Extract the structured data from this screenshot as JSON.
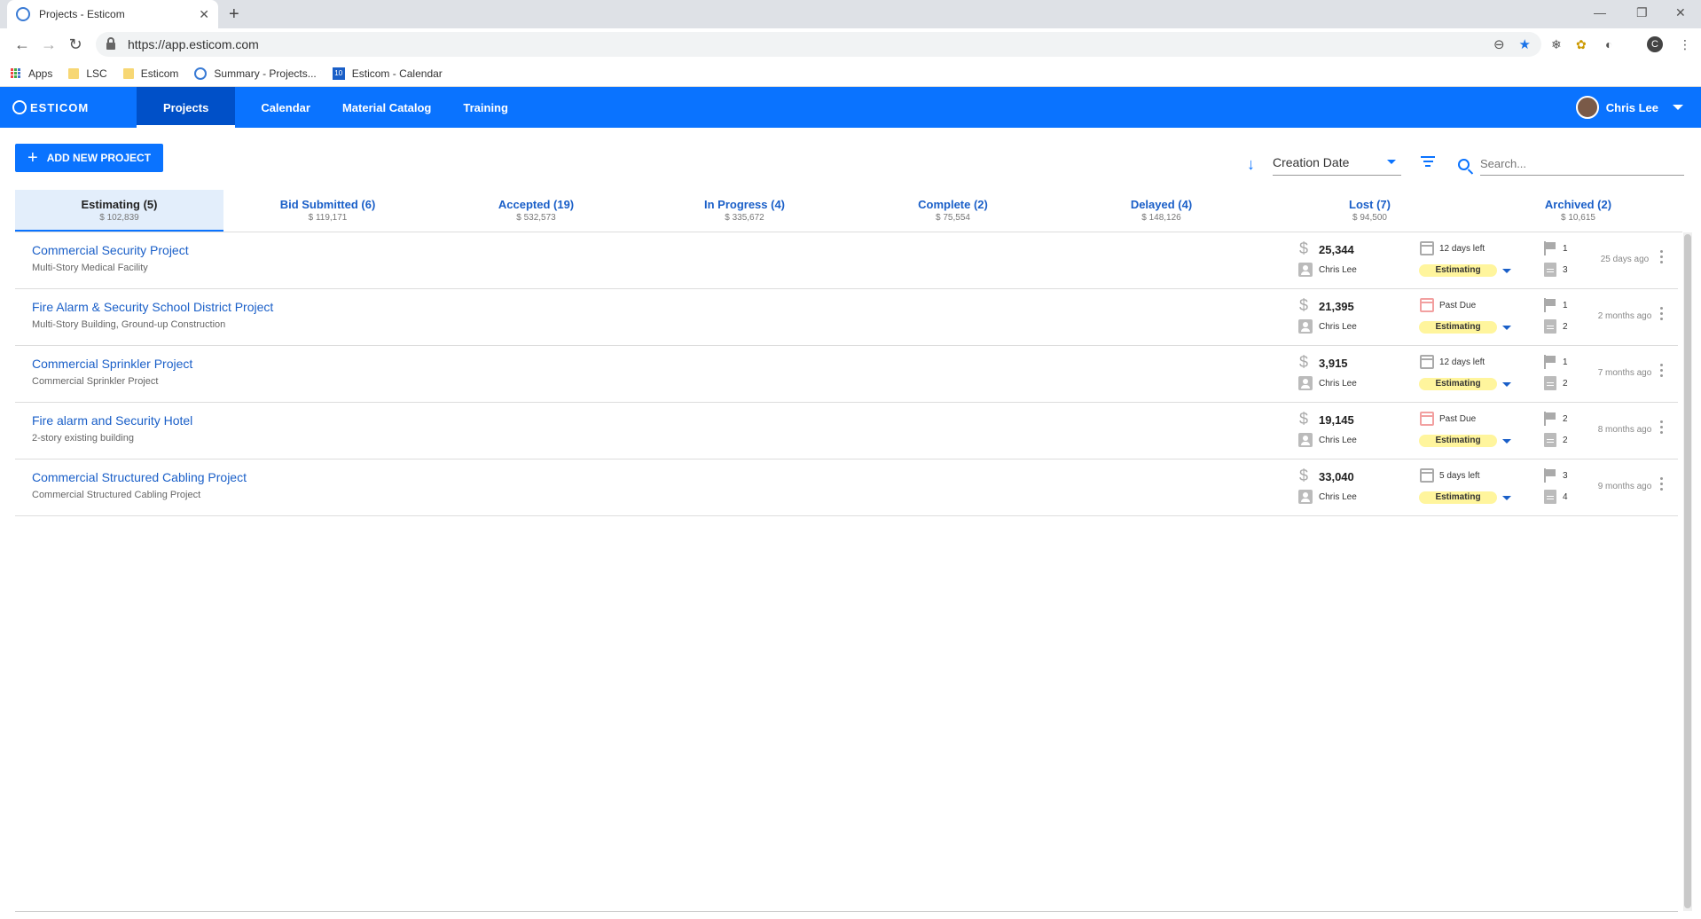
{
  "browser": {
    "tab_title": "Projects - Esticom",
    "url": "https://app.esticom.com",
    "bookmarks": [
      {
        "label": "Apps"
      },
      {
        "label": "LSC"
      },
      {
        "label": "Esticom"
      },
      {
        "label": "Summary - Projects..."
      },
      {
        "label": "Esticom - Calendar"
      }
    ],
    "profile_initial": "C"
  },
  "app": {
    "logo": "ESTICOM",
    "nav": [
      {
        "label": "Projects",
        "active": true
      },
      {
        "label": "Calendar"
      },
      {
        "label": "Material Catalog"
      },
      {
        "label": "Training"
      }
    ],
    "user_name": "Chris Lee",
    "brand_color": "#0a73ff"
  },
  "toolbar": {
    "add_label": "ADD NEW PROJECT",
    "sort_value": "Creation Date",
    "search_placeholder": "Search..."
  },
  "status_tabs": [
    {
      "label": "Estimating (5)",
      "amount": "$ 102,839",
      "active": true
    },
    {
      "label": "Bid Submitted (6)",
      "amount": "$ 119,171"
    },
    {
      "label": "Accepted (19)",
      "amount": "$ 532,573"
    },
    {
      "label": "In Progress (4)",
      "amount": "$ 335,672"
    },
    {
      "label": "Complete (2)",
      "amount": "$ 75,554"
    },
    {
      "label": "Delayed (4)",
      "amount": "$ 148,126"
    },
    {
      "label": "Lost (7)",
      "amount": "$ 94,500"
    },
    {
      "label": "Archived (2)",
      "amount": "$ 10,615"
    }
  ],
  "projects": [
    {
      "title": "Commercial Security Project",
      "subtitle": "Multi-Story Medical Facility",
      "amount": "25,344",
      "owner": "Chris Lee",
      "due": "12 days left",
      "past_due": false,
      "status": "Estimating",
      "flags": "1",
      "docs": "3",
      "created": "25 days ago"
    },
    {
      "title": "Fire Alarm & Security School District Project",
      "subtitle": "Multi-Story Building, Ground-up Construction",
      "amount": "21,395",
      "owner": "Chris Lee",
      "due": "Past Due",
      "past_due": true,
      "status": "Estimating",
      "flags": "1",
      "docs": "2",
      "created": "2 months ago"
    },
    {
      "title": "Commercial Sprinkler Project",
      "subtitle": "Commercial Sprinkler Project",
      "amount": "3,915",
      "owner": "Chris Lee",
      "due": "12 days left",
      "past_due": false,
      "status": "Estimating",
      "flags": "1",
      "docs": "2",
      "created": "7 months ago"
    },
    {
      "title": "Fire alarm and Security Hotel",
      "subtitle": "2-story existing building",
      "amount": "19,145",
      "owner": "Chris Lee",
      "due": "Past Due",
      "past_due": true,
      "status": "Estimating",
      "flags": "2",
      "docs": "2",
      "created": "8 months ago"
    },
    {
      "title": "Commercial Structured Cabling Project",
      "subtitle": "Commercial Structured Cabling Project",
      "amount": "33,040",
      "owner": "Chris Lee",
      "due": "5 days left",
      "past_due": false,
      "status": "Estimating",
      "flags": "3",
      "docs": "4",
      "created": "9 months ago"
    }
  ]
}
